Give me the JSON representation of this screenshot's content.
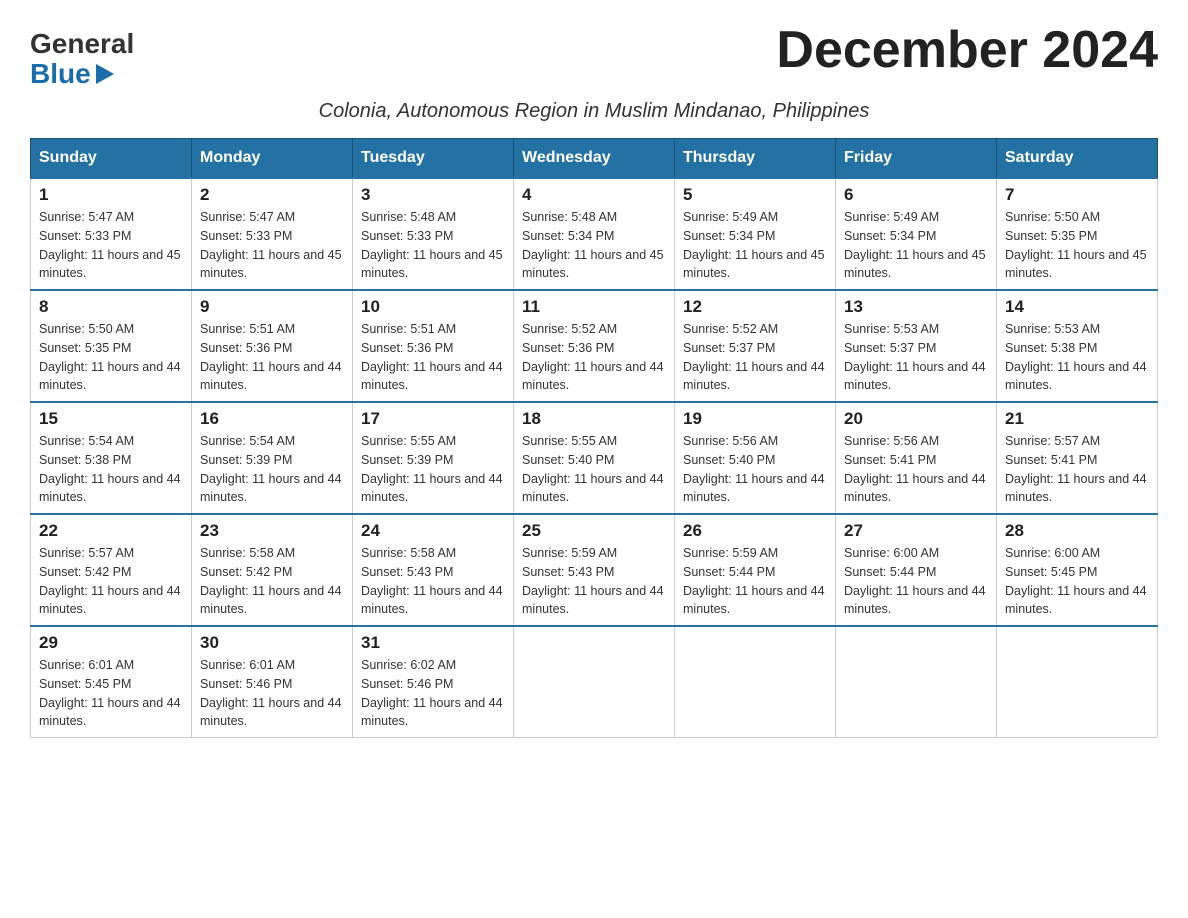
{
  "logo": {
    "general": "General",
    "blue": "Blue"
  },
  "title": "December 2024",
  "subtitle": "Colonia, Autonomous Region in Muslim Mindanao, Philippines",
  "days_of_week": [
    "Sunday",
    "Monday",
    "Tuesday",
    "Wednesday",
    "Thursday",
    "Friday",
    "Saturday"
  ],
  "weeks": [
    [
      {
        "day": "1",
        "sunrise": "5:47 AM",
        "sunset": "5:33 PM",
        "daylight": "11 hours and 45 minutes."
      },
      {
        "day": "2",
        "sunrise": "5:47 AM",
        "sunset": "5:33 PM",
        "daylight": "11 hours and 45 minutes."
      },
      {
        "day": "3",
        "sunrise": "5:48 AM",
        "sunset": "5:33 PM",
        "daylight": "11 hours and 45 minutes."
      },
      {
        "day": "4",
        "sunrise": "5:48 AM",
        "sunset": "5:34 PM",
        "daylight": "11 hours and 45 minutes."
      },
      {
        "day": "5",
        "sunrise": "5:49 AM",
        "sunset": "5:34 PM",
        "daylight": "11 hours and 45 minutes."
      },
      {
        "day": "6",
        "sunrise": "5:49 AM",
        "sunset": "5:34 PM",
        "daylight": "11 hours and 45 minutes."
      },
      {
        "day": "7",
        "sunrise": "5:50 AM",
        "sunset": "5:35 PM",
        "daylight": "11 hours and 45 minutes."
      }
    ],
    [
      {
        "day": "8",
        "sunrise": "5:50 AM",
        "sunset": "5:35 PM",
        "daylight": "11 hours and 44 minutes."
      },
      {
        "day": "9",
        "sunrise": "5:51 AM",
        "sunset": "5:36 PM",
        "daylight": "11 hours and 44 minutes."
      },
      {
        "day": "10",
        "sunrise": "5:51 AM",
        "sunset": "5:36 PM",
        "daylight": "11 hours and 44 minutes."
      },
      {
        "day": "11",
        "sunrise": "5:52 AM",
        "sunset": "5:36 PM",
        "daylight": "11 hours and 44 minutes."
      },
      {
        "day": "12",
        "sunrise": "5:52 AM",
        "sunset": "5:37 PM",
        "daylight": "11 hours and 44 minutes."
      },
      {
        "day": "13",
        "sunrise": "5:53 AM",
        "sunset": "5:37 PM",
        "daylight": "11 hours and 44 minutes."
      },
      {
        "day": "14",
        "sunrise": "5:53 AM",
        "sunset": "5:38 PM",
        "daylight": "11 hours and 44 minutes."
      }
    ],
    [
      {
        "day": "15",
        "sunrise": "5:54 AM",
        "sunset": "5:38 PM",
        "daylight": "11 hours and 44 minutes."
      },
      {
        "day": "16",
        "sunrise": "5:54 AM",
        "sunset": "5:39 PM",
        "daylight": "11 hours and 44 minutes."
      },
      {
        "day": "17",
        "sunrise": "5:55 AM",
        "sunset": "5:39 PM",
        "daylight": "11 hours and 44 minutes."
      },
      {
        "day": "18",
        "sunrise": "5:55 AM",
        "sunset": "5:40 PM",
        "daylight": "11 hours and 44 minutes."
      },
      {
        "day": "19",
        "sunrise": "5:56 AM",
        "sunset": "5:40 PM",
        "daylight": "11 hours and 44 minutes."
      },
      {
        "day": "20",
        "sunrise": "5:56 AM",
        "sunset": "5:41 PM",
        "daylight": "11 hours and 44 minutes."
      },
      {
        "day": "21",
        "sunrise": "5:57 AM",
        "sunset": "5:41 PM",
        "daylight": "11 hours and 44 minutes."
      }
    ],
    [
      {
        "day": "22",
        "sunrise": "5:57 AM",
        "sunset": "5:42 PM",
        "daylight": "11 hours and 44 minutes."
      },
      {
        "day": "23",
        "sunrise": "5:58 AM",
        "sunset": "5:42 PM",
        "daylight": "11 hours and 44 minutes."
      },
      {
        "day": "24",
        "sunrise": "5:58 AM",
        "sunset": "5:43 PM",
        "daylight": "11 hours and 44 minutes."
      },
      {
        "day": "25",
        "sunrise": "5:59 AM",
        "sunset": "5:43 PM",
        "daylight": "11 hours and 44 minutes."
      },
      {
        "day": "26",
        "sunrise": "5:59 AM",
        "sunset": "5:44 PM",
        "daylight": "11 hours and 44 minutes."
      },
      {
        "day": "27",
        "sunrise": "6:00 AM",
        "sunset": "5:44 PM",
        "daylight": "11 hours and 44 minutes."
      },
      {
        "day": "28",
        "sunrise": "6:00 AM",
        "sunset": "5:45 PM",
        "daylight": "11 hours and 44 minutes."
      }
    ],
    [
      {
        "day": "29",
        "sunrise": "6:01 AM",
        "sunset": "5:45 PM",
        "daylight": "11 hours and 44 minutes."
      },
      {
        "day": "30",
        "sunrise": "6:01 AM",
        "sunset": "5:46 PM",
        "daylight": "11 hours and 44 minutes."
      },
      {
        "day": "31",
        "sunrise": "6:02 AM",
        "sunset": "5:46 PM",
        "daylight": "11 hours and 44 minutes."
      },
      null,
      null,
      null,
      null
    ]
  ]
}
